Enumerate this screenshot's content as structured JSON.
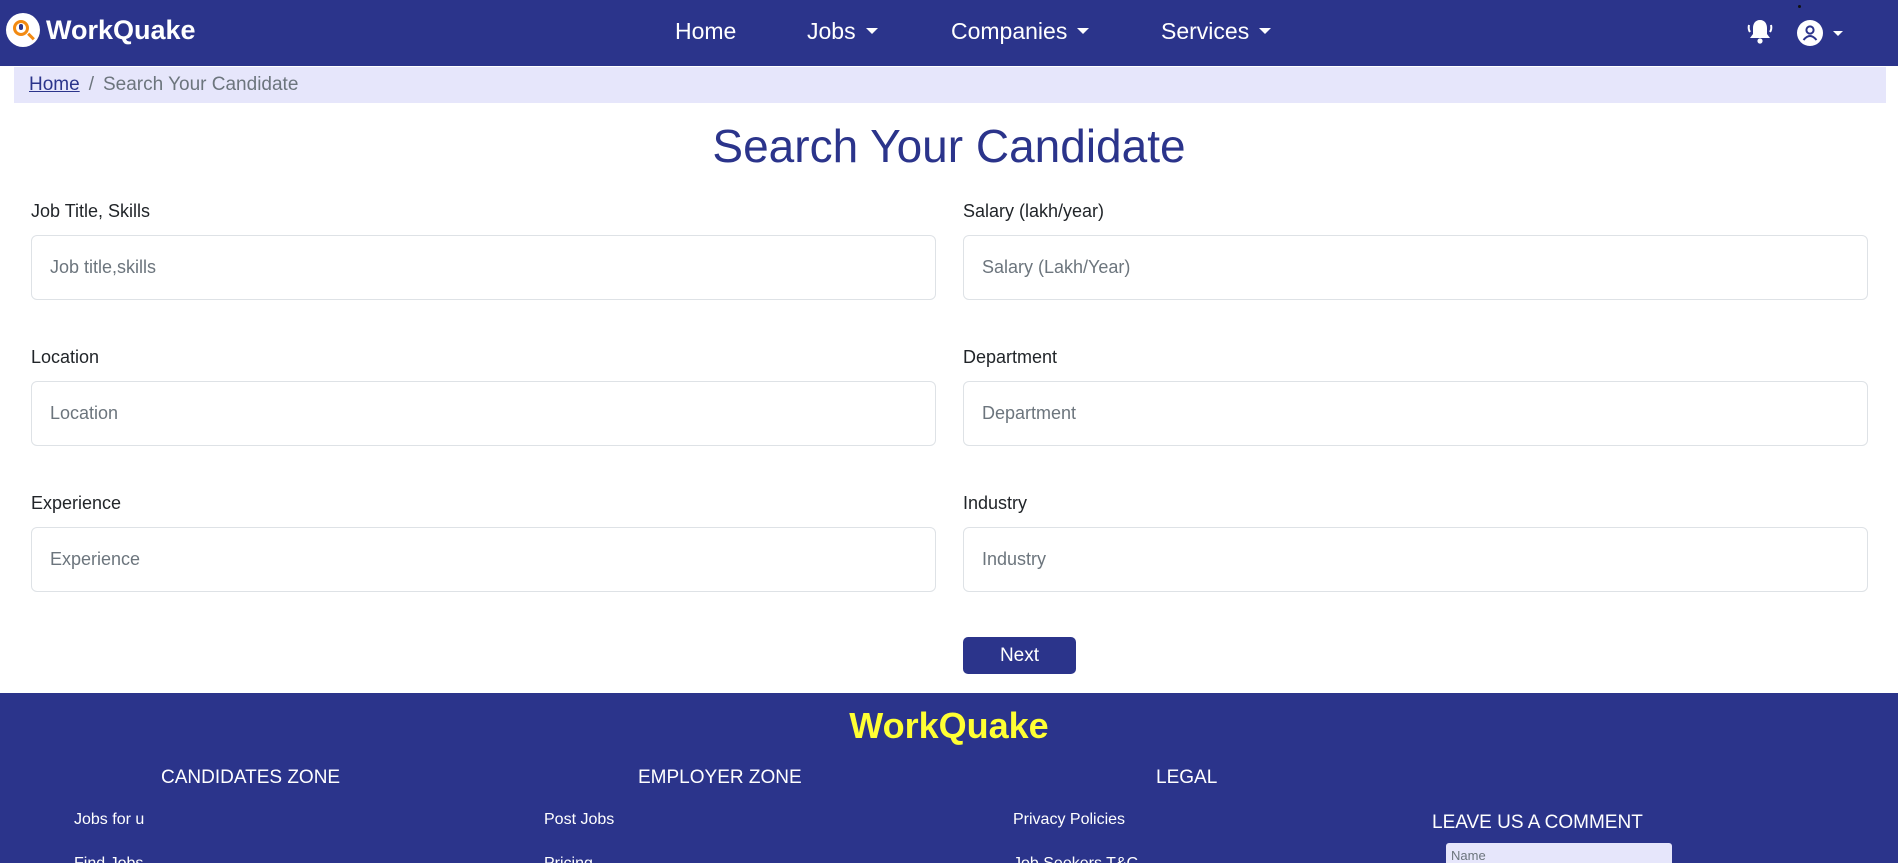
{
  "navbar": {
    "brand": "WorkQuake",
    "links": [
      {
        "label": "Home"
      },
      {
        "label": "Jobs"
      },
      {
        "label": "Companies"
      },
      {
        "label": "Services"
      }
    ],
    "icons": {
      "notifications": "bell-icon",
      "user": "user-circle-icon",
      "dropdown": "caret-down-icon"
    }
  },
  "breadcrumb": {
    "home": "Home",
    "separator": "/",
    "current": "Search Your Candidate"
  },
  "page": {
    "title": "Search Your Candidate"
  },
  "form": {
    "job_title": {
      "label": "Job Title, Skills",
      "placeholder": "Job title,skills",
      "value": ""
    },
    "salary": {
      "label": "Salary (lakh/year)",
      "placeholder": "Salary (Lakh/Year)",
      "value": ""
    },
    "location": {
      "label": "Location",
      "placeholder": "Location",
      "value": ""
    },
    "department": {
      "label": "Department",
      "placeholder": "Department",
      "value": ""
    },
    "experience": {
      "label": "Experience",
      "placeholder": "Experience",
      "value": ""
    },
    "industry": {
      "label": "Industry",
      "placeholder": "Industry",
      "value": ""
    },
    "next_label": "Next"
  },
  "footer": {
    "brand": "WorkQuake",
    "candidates_heading": "CANDIDATES ZONE",
    "employer_heading": "EMPLOYER ZONE",
    "legal_heading": "LEGAL",
    "candidates_links": [
      "Jobs for u",
      "Find Jobs"
    ],
    "employer_links": [
      "Post Jobs",
      "Pricing"
    ],
    "legal_links": [
      "Privacy Policies",
      "Job Seekers T&C"
    ],
    "comment_heading": "LEAVE US A COMMENT",
    "comment_name_placeholder": "Name"
  },
  "colors": {
    "primary": "#2b348b",
    "breadcrumb_bg": "#e6e6fb",
    "footer_brand": "#ffff33",
    "logo_accent": "#f28a12"
  }
}
